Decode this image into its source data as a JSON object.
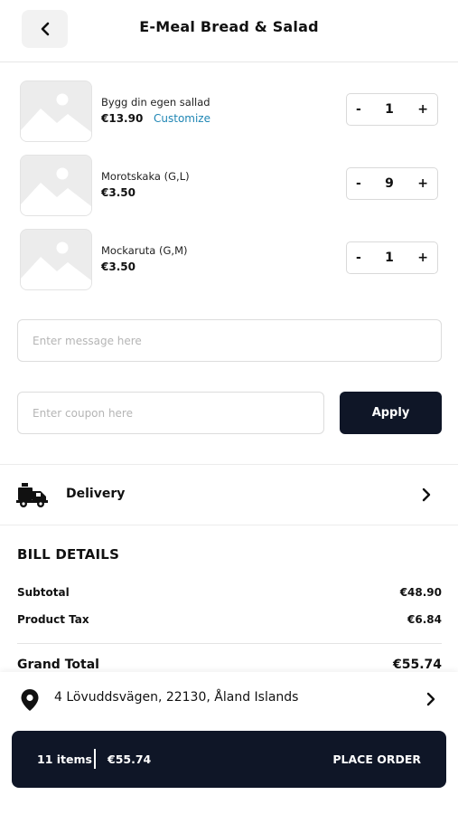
{
  "header": {
    "title": "E-Meal Bread & Salad",
    "back_icon": "chevron-left-icon"
  },
  "cart": {
    "items": [
      {
        "name": "Bygg din egen sallad",
        "price": "€13.90",
        "customize_label": "Customize",
        "qty": "1",
        "minus": "-",
        "plus": "+"
      },
      {
        "name": "Morotskaka (G,L)",
        "price": "€3.50",
        "qty": "9",
        "minus": "-",
        "plus": "+"
      },
      {
        "name": "Mockaruta (G,M)",
        "price": "€3.50",
        "qty": "1",
        "minus": "-",
        "plus": "+"
      }
    ]
  },
  "message": {
    "placeholder": "Enter message here",
    "value": ""
  },
  "coupon": {
    "placeholder": "Enter coupon here",
    "value": "",
    "apply_label": "Apply"
  },
  "delivery": {
    "label": "Delivery",
    "icon": "delivery-truck-icon"
  },
  "bill": {
    "title": "BILL DETAILS",
    "subtotal_label": "Subtotal",
    "subtotal_value": "€48.90",
    "tax_label": "Product Tax",
    "tax_value": "€6.84",
    "grand_total_label": "Grand Total",
    "grand_total_value": "€55.74"
  },
  "address": {
    "text": "4 Lövuddsvägen, 22130, Åland Islands",
    "icon": "location-pin-icon"
  },
  "order_bar": {
    "items_count": "11 items",
    "total": "€55.74",
    "cta": "PLACE ORDER"
  },
  "colors": {
    "accent_dark": "#0f1627",
    "link_blue": "#1f86b4"
  }
}
